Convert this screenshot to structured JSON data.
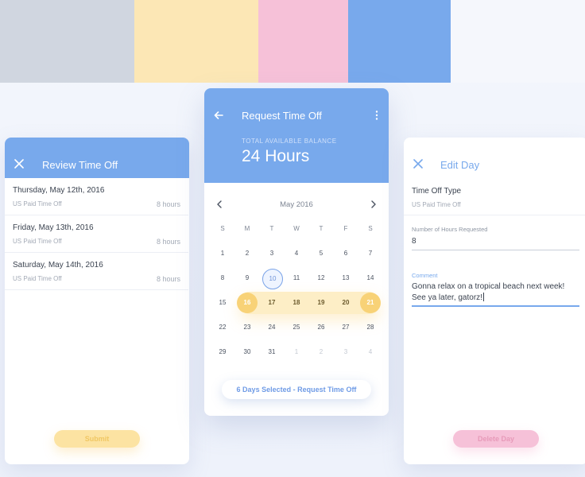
{
  "palette": {
    "colors": [
      "#d0d6e0",
      "#fce7b5",
      "#f6c1d8",
      "#78a9ec",
      "#f5f7fc"
    ]
  },
  "review": {
    "title": "Review Time Off",
    "close_icon": "close-icon",
    "rows": [
      {
        "date": "Thursday, May 12th, 2016",
        "type": "US Paid Time Off",
        "hours": "8 hours"
      },
      {
        "date": "Friday, May 13th, 2016",
        "type": "US Paid Time Off",
        "hours": "8 hours"
      },
      {
        "date": "Saturday, May 14th, 2016",
        "type": "US Paid Time Off",
        "hours": "8 hours"
      }
    ],
    "submit_label": "Submit"
  },
  "request": {
    "title": "Request Time Off",
    "back_icon": "arrow-left-icon",
    "menu_icon": "more-vertical-icon",
    "balance_label": "TOTAL AVAILABLE BALANCE",
    "balance_value": "24 Hours",
    "month": "May 2016",
    "weekdays": [
      "S",
      "M",
      "T",
      "W",
      "T",
      "F",
      "S"
    ],
    "weeks": [
      [
        "1",
        "2",
        "3",
        "4",
        "5",
        "6",
        "7"
      ],
      [
        "8",
        "9",
        "10",
        "11",
        "12",
        "13",
        "14"
      ],
      [
        "15",
        "16",
        "17",
        "18",
        "19",
        "20",
        "21"
      ],
      [
        "22",
        "23",
        "24",
        "25",
        "26",
        "27",
        "28"
      ],
      [
        "29",
        "30",
        "31",
        "1",
        "2",
        "3",
        "4"
      ]
    ],
    "today": "10",
    "range_start": "16",
    "range_end": "21",
    "cta_label": "6 Days Selected - Request Time Off"
  },
  "edit": {
    "title": "Edit Day",
    "close_icon": "close-icon",
    "type_label": "Time Off Type",
    "type_value": "US Paid Time Off",
    "hours_label": "Number of Hours Requested",
    "hours_value": "8",
    "comment_label": "Comment",
    "comment_line1": "Gonna relax on a tropical beach next week!",
    "comment_line2": "See ya later, gatorz!",
    "delete_label": "Delete Day"
  },
  "colors": {
    "primary": "#78a9ec",
    "accent_yellow": "#f8d277",
    "range_yellow": "#fdeec6",
    "pink": "#f6c1d8",
    "text_dark": "#3b4350",
    "text_muted": "#a3aab6"
  }
}
